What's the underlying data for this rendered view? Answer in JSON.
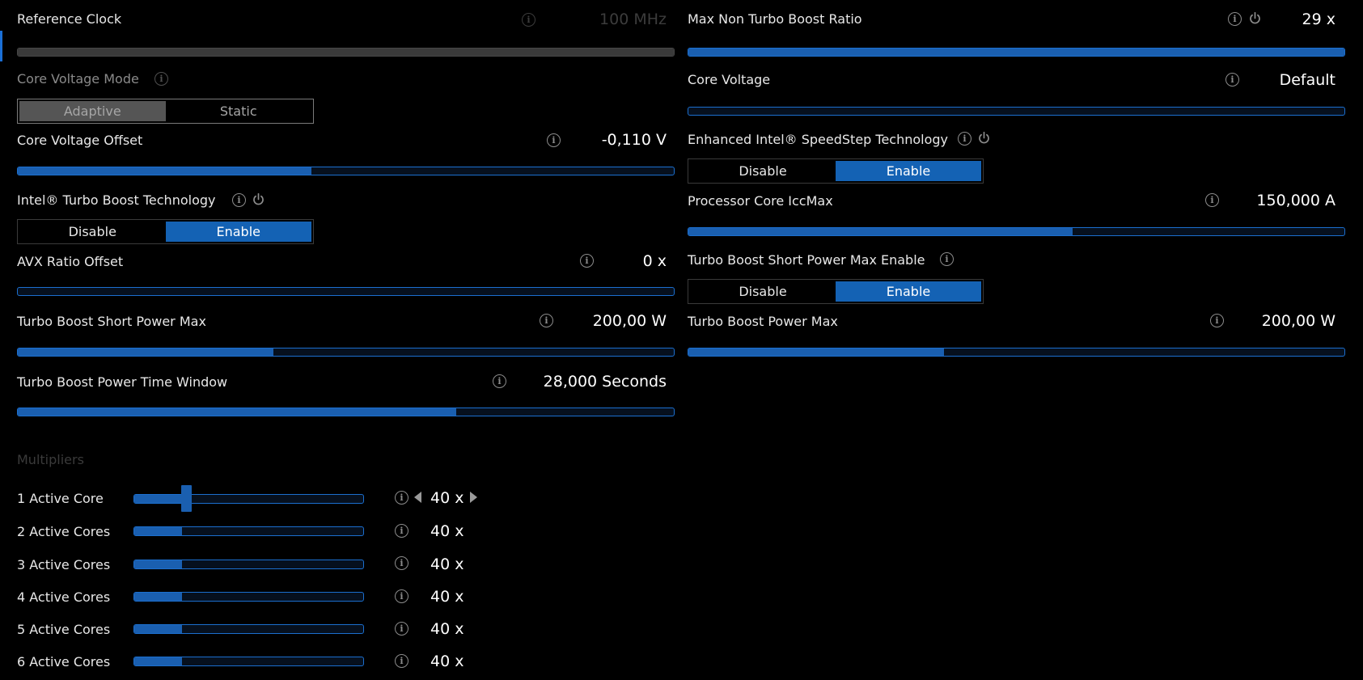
{
  "left": {
    "reference_clock": {
      "label": "Reference Clock",
      "value": "100 MHz",
      "fill": 1.0
    },
    "core_voltage_mode": {
      "label": "Core Voltage Mode",
      "options": [
        "Adaptive",
        "Static"
      ],
      "selected": "Adaptive"
    },
    "core_voltage_offset": {
      "label": "Core Voltage Offset",
      "value": "-0,110 V",
      "fill": 0.447
    },
    "turbo_boost_tech": {
      "label": "Intel® Turbo Boost Technology",
      "options": [
        "Disable",
        "Enable"
      ],
      "selected": "Enable"
    },
    "avx_ratio_offset": {
      "label": "AVX Ratio Offset",
      "value": "0 x",
      "fill": 0.0
    },
    "turbo_short_power_max": {
      "label": "Turbo Boost Short Power Max",
      "value": "200,00 W",
      "fill": 0.39
    },
    "turbo_power_time_window": {
      "label": "Turbo Boost Power Time Window",
      "value": "28,000 Seconds",
      "fill": 0.668
    }
  },
  "right": {
    "max_non_turbo_ratio": {
      "label": "Max Non Turbo Boost Ratio",
      "value": "29 x",
      "fill": 1.0
    },
    "core_voltage": {
      "label": "Core Voltage",
      "value": "Default",
      "fill": 0.0
    },
    "speedstep": {
      "label": "Enhanced Intel® SpeedStep Technology",
      "options": [
        "Disable",
        "Enable"
      ],
      "selected": "Enable"
    },
    "core_iccmax": {
      "label": "Processor Core IccMax",
      "value": "150,000 A",
      "fill": 0.586
    },
    "short_power_max_enable": {
      "label": "Turbo Boost Short Power Max Enable",
      "options": [
        "Disable",
        "Enable"
      ],
      "selected": "Enable"
    },
    "turbo_power_max": {
      "label": "Turbo Boost Power Max",
      "value": "200,00 W",
      "fill": 0.39
    }
  },
  "multipliers": {
    "title": "Multipliers",
    "rows": [
      {
        "label": "1 Active Core",
        "value": "40 x",
        "fill": 0.23
      },
      {
        "label": "2 Active Cores",
        "value": "40 x",
        "fill": 0.21
      },
      {
        "label": "3 Active Cores",
        "value": "40 x",
        "fill": 0.21
      },
      {
        "label": "4 Active Cores",
        "value": "40 x",
        "fill": 0.21
      },
      {
        "label": "5 Active Cores",
        "value": "40 x",
        "fill": 0.21
      },
      {
        "label": "6 Active Cores",
        "value": "40 x",
        "fill": 0.21
      }
    ]
  },
  "colors": {
    "accent": "#1462b4",
    "track_border": "#1b6fcf",
    "background": "#000000"
  }
}
